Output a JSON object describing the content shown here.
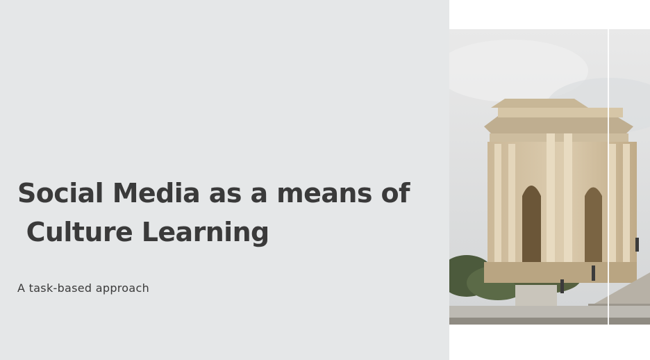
{
  "slide": {
    "title_line1": "Social Media as a means of",
    "title_line2": " Culture Learning",
    "subtitle": "A task-based approach"
  },
  "colors": {
    "panel_background": "#e5e7e8",
    "text": "#3a3a3a"
  }
}
